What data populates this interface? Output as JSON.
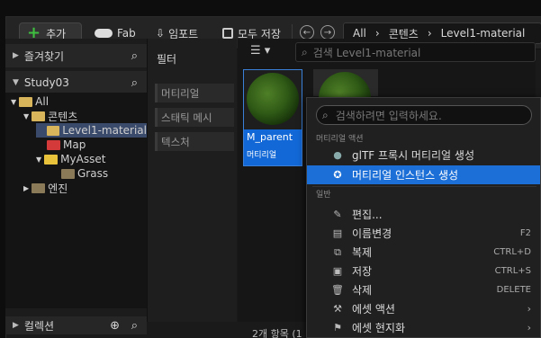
{
  "toolbar": {
    "add": "추가",
    "fab": "Fab",
    "import": "임포트",
    "save_all": "모두 저장"
  },
  "breadcrumb": [
    "All",
    "콘텐츠",
    "Level1-material"
  ],
  "left": {
    "favorites": "즐겨찾기",
    "project": "Study03",
    "collections": "컬렉션"
  },
  "tree": [
    "All",
    "콘텐츠",
    "Level1-material",
    "Map",
    "MyAsset",
    "Grass",
    "엔진"
  ],
  "filters": {
    "title": "필터",
    "items": [
      "머티리얼",
      "스태틱 메시",
      "텍스처"
    ]
  },
  "search": {
    "placeholder": "검색 Level1-material"
  },
  "asset": {
    "name": "M_parent",
    "type": "머티리얼"
  },
  "status": "2개 항목 (1",
  "menu": {
    "search_placeholder": "검색하려면 입력하세요.",
    "section_material": "머티리얼 액션",
    "material_items": [
      "glTF 프록시 머티리얼 생성",
      "머티리얼 인스턴스 생성"
    ],
    "section_general": "일반",
    "general_items": [
      "편집...",
      "이름변경",
      "복제",
      "저장",
      "삭제",
      "에셋 액션",
      "에셋 현지화"
    ],
    "shortcuts": {
      "rename": "F2",
      "duplicate": "CTRL+D",
      "save": "CTRL+S",
      "delete": "DELETE"
    }
  }
}
